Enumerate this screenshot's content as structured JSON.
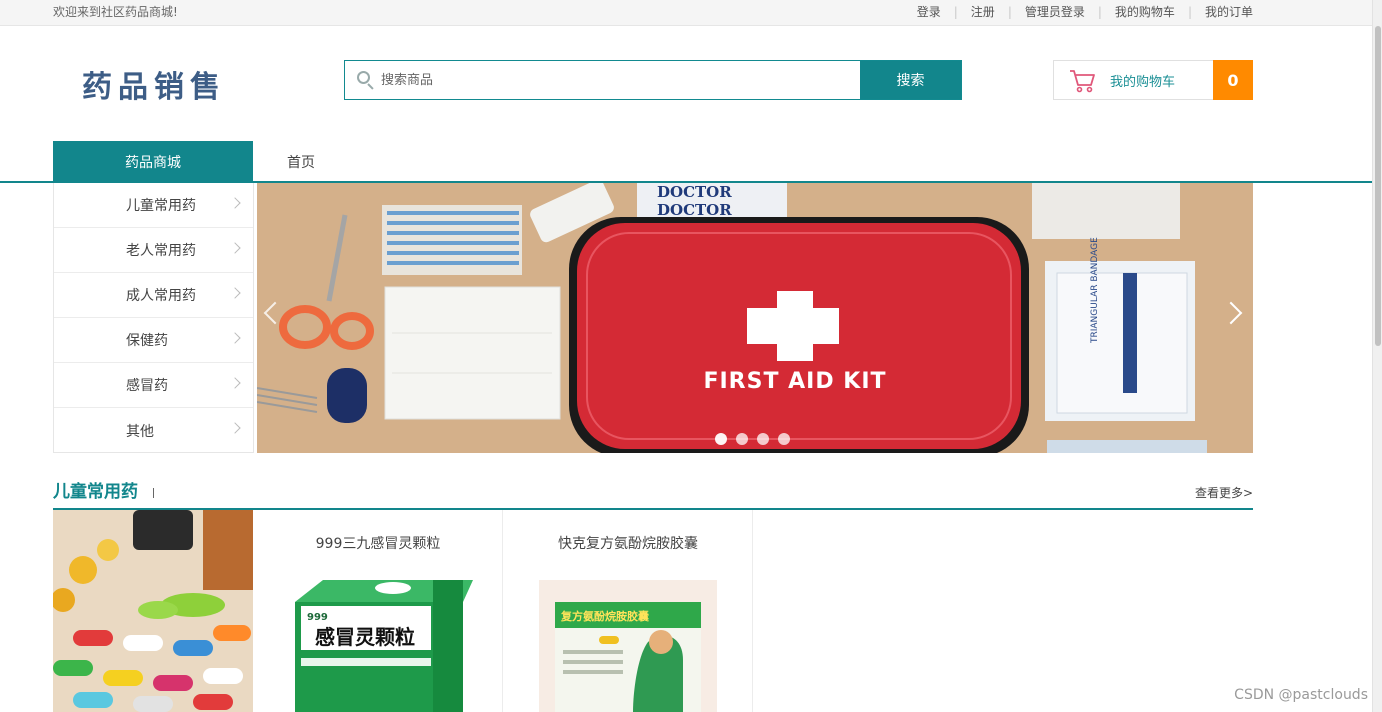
{
  "topbar": {
    "welcome": "欢迎来到社区药品商城!",
    "links": [
      "登录",
      "注册",
      "管理员登录",
      "我的购物车",
      "我的订单"
    ]
  },
  "header": {
    "logo": "药品销售",
    "search_placeholder": "搜索商品",
    "search_button": "搜索",
    "cart_label": "我的购物车",
    "cart_count": "0"
  },
  "nav": {
    "category_title": "药品商城",
    "home": "首页"
  },
  "sidebar": {
    "items": [
      {
        "label": "儿童常用药"
      },
      {
        "label": "老人常用药"
      },
      {
        "label": "成人常用药"
      },
      {
        "label": "保健药"
      },
      {
        "label": "感冒药"
      },
      {
        "label": "其他"
      }
    ]
  },
  "banner": {
    "text": "FIRST AID KIT",
    "doctor_text": "DOCTOR",
    "bandage_text": "TRIANGULAR BANDAGE",
    "slide_count": 4,
    "active_slide": 1
  },
  "section": {
    "title": "儿童常用药",
    "more": "查看更多>",
    "products": [
      {
        "name": "999三九感冒灵颗粒",
        "box_text": "感冒灵颗粒",
        "brand": "999"
      },
      {
        "name": "快克复方氨酚烷胺胶囊",
        "box_text": "复方氨酚烷胺胶囊"
      }
    ]
  },
  "watermark": "CSDN @pastclouds",
  "colors": {
    "accent": "#12868c",
    "cart_count_bg": "#ff8a00",
    "logo": "#3d5d86"
  }
}
